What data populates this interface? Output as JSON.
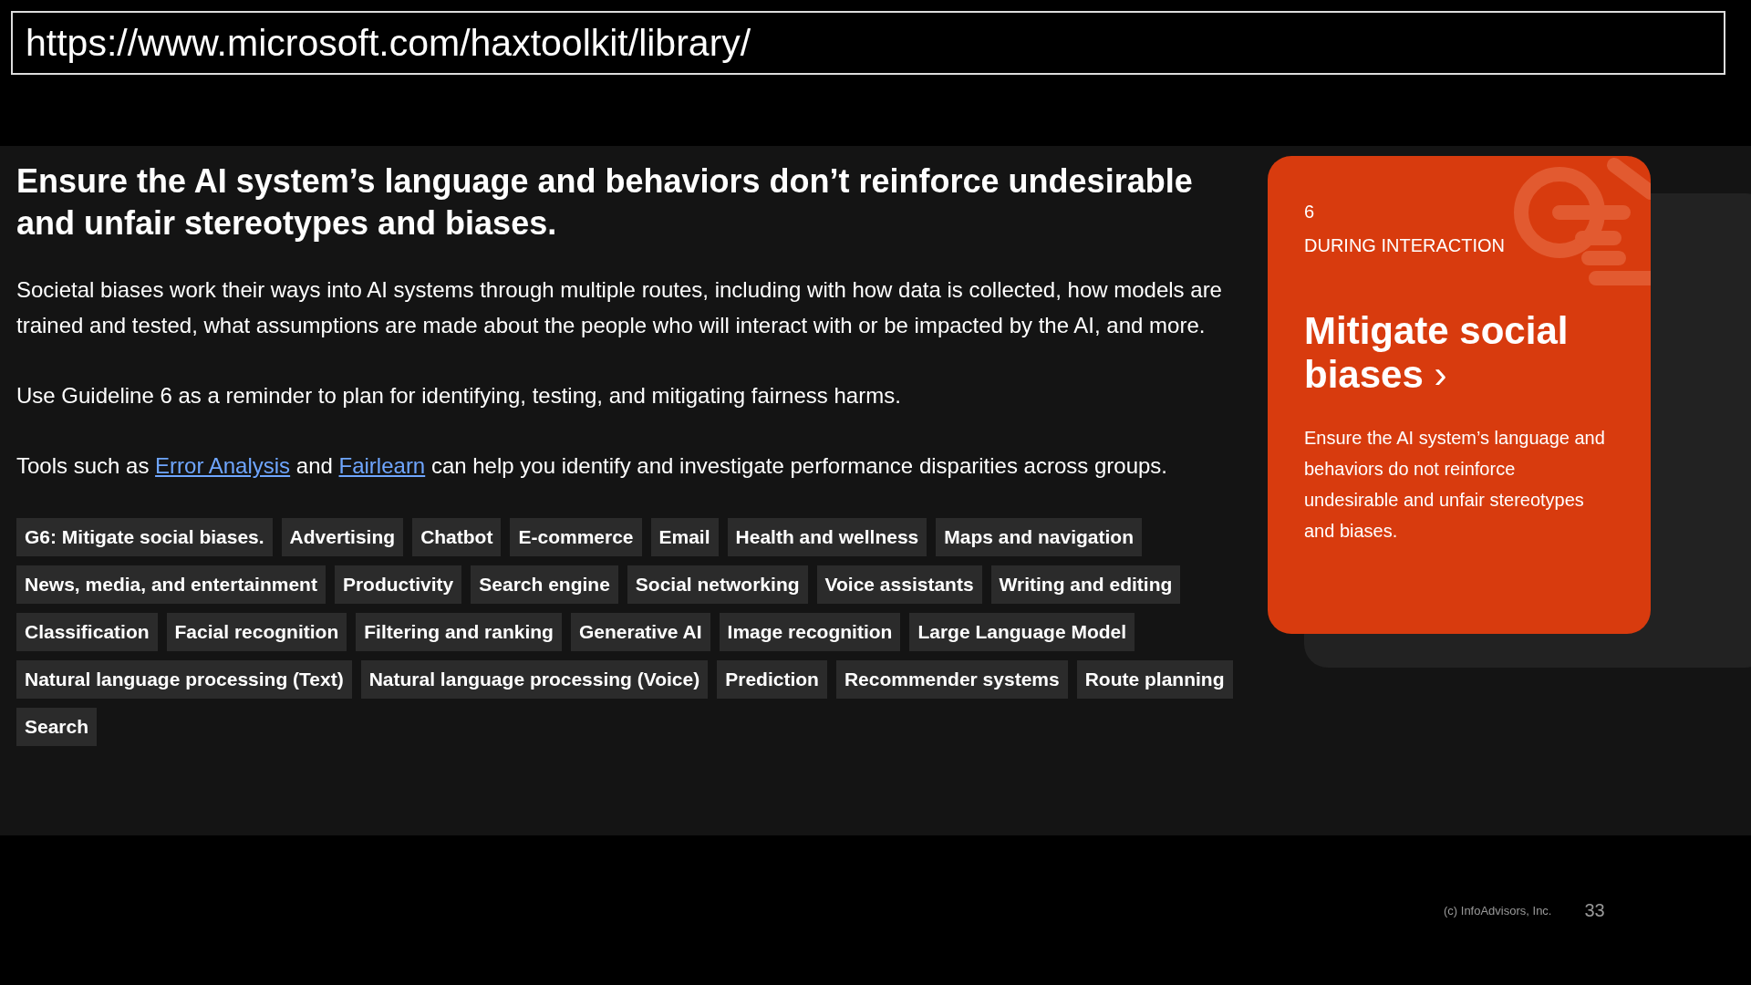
{
  "url_bar": {
    "text": "https://www.microsoft.com/haxtoolkit/library/"
  },
  "guideline": {
    "heading": "Ensure the AI system’s language and behaviors don’t reinforce undesirable and unfair stereotypes and biases.",
    "paragraphs": [
      [
        {
          "kind": "text",
          "text": "Societal biases work their ways into AI systems through multiple routes, including with how data is collected, how models are trained and tested, what assumptions are made about the people who will interact with or be impacted by the AI, and more."
        }
      ],
      [
        {
          "kind": "text",
          "text": "Use Guideline 6 as a reminder to plan for identifying, testing, and mitigating fairness harms."
        }
      ],
      [
        {
          "kind": "text",
          "text": "Tools such as "
        },
        {
          "kind": "link",
          "text": "Error Analysis"
        },
        {
          "kind": "text",
          "text": " and "
        },
        {
          "kind": "link",
          "text": "Fairlearn"
        },
        {
          "kind": "text",
          "text": " can help you identify and investigate performance disparities across groups."
        }
      ]
    ],
    "tags": [
      "G6: Mitigate social biases.",
      "Advertising",
      "Chatbot",
      "E-commerce",
      "Email",
      "Health and wellness",
      "Maps and navigation",
      "News, media, and entertainment",
      "Productivity",
      "Search engine",
      "Social networking",
      "Voice assistants",
      "Writing and editing",
      "Classification",
      "Facial recognition",
      "Filtering and ranking",
      "Generative AI",
      "Image recognition",
      "Large Language Model",
      "Natural language processing (Text)",
      "Natural language processing (Voice)",
      "Prediction",
      "Recommender systems",
      "Route planning",
      "Search"
    ]
  },
  "card": {
    "number": "6",
    "phase": "DURING INTERACTION",
    "title": "Mitigate social biases",
    "arrow": "›",
    "description": "Ensure the AI system’s language and behaviors do not reinforce undesirable and unfair stereotypes and biases."
  },
  "footer": {
    "copyright": "(c) InfoAdvisors, Inc.",
    "page_number": "33"
  }
}
